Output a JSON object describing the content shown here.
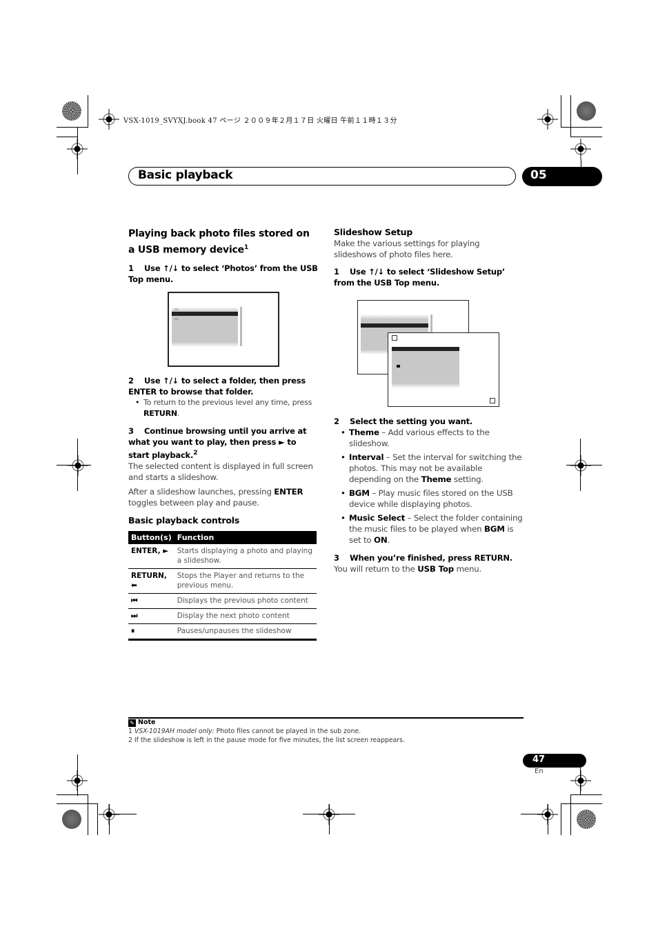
{
  "print_header": "VSX-1019_SVYXJ.book  47 ページ  ２００９年２月１７日  火曜日  午前１１時１３分",
  "chapter": {
    "title": "Basic playback",
    "number": "05"
  },
  "left_column": {
    "section_title": "Playing back photo files stored on a USB memory device",
    "section_title_footnote": "1",
    "step1": {
      "num": "1",
      "text_before": "Use ",
      "arrows": "↑/↓",
      "text_after": " to select ‘Photos’ from the USB Top menu."
    },
    "step2": {
      "num": "2",
      "text_before": "Use ",
      "arrows": "↑/↓",
      "text_after": " to select a folder, then press ENTER to browse that folder."
    },
    "step2_bullet": {
      "text": "To return to the previous level any time, press ",
      "bold": "RETURN",
      "end": "."
    },
    "step3": {
      "num": "3",
      "text": "Continue browsing until you arrive at what you want to play, then press ► to start playback.",
      "footnote": "2"
    },
    "para1": "The selected content is displayed in full screen and starts a slideshow.",
    "para2": {
      "text": "After a slideshow launches, pressing ",
      "bold": "ENTER",
      "end": " toggles between play and pause."
    },
    "controls_title": "Basic playback controls",
    "table": {
      "headers": [
        "Button(s)",
        "Function"
      ],
      "rows": [
        {
          "button": "ENTER, ►",
          "function": "Starts displaying a photo and playing a slideshow."
        },
        {
          "button": "RETURN, ⬅",
          "function": "Stops the Player and returns to the previous menu."
        },
        {
          "button": "⏮",
          "function": "Displays the previous photo content"
        },
        {
          "button": "⏭",
          "function": "Display the next photo content"
        },
        {
          "button": "⏸",
          "function": "Pauses/unpauses the slideshow"
        }
      ]
    }
  },
  "right_column": {
    "section_title": "Slideshow Setup",
    "intro": "Make the various settings for playing slideshows of photo files here.",
    "step1": {
      "num": "1",
      "text_before": "Use ",
      "arrows": "↑/↓",
      "text_after": " to select ‘Slideshow Setup’ from the USB Top menu."
    },
    "step2": {
      "num": "2",
      "text": "Select the setting you want."
    },
    "bullets": [
      {
        "term": "Theme",
        "desc": " – Add various effects to the slideshow."
      },
      {
        "term": "Interval",
        "desc": " – Set the interval for switching the photos. This may not be available depending on the ",
        "bold2": "Theme",
        "end": " setting."
      },
      {
        "term": "BGM",
        "desc": " – Play music files stored on the USB device while displaying photos."
      },
      {
        "term": "Music Select",
        "desc": " – Select the folder containing the music files to be played when ",
        "bold2": "BGM",
        "mid": " is set to ",
        "bold3": "ON",
        "end": "."
      }
    ],
    "step3": {
      "num": "3",
      "text": "When you’re finished, press RETURN."
    },
    "step3_para": {
      "text": "You will return to the ",
      "bold": "USB Top",
      "end": " menu."
    }
  },
  "notes": {
    "title": "Note",
    "items": [
      {
        "num": "1",
        "italic": "VSX-1019AH model only:",
        "text": " Photo files cannot be played in the sub zone."
      },
      {
        "num": "2",
        "text": "If the slideshow is left in the pause mode for five minutes, the list screen reappears."
      }
    ]
  },
  "page": {
    "number": "47",
    "lang": "En"
  }
}
